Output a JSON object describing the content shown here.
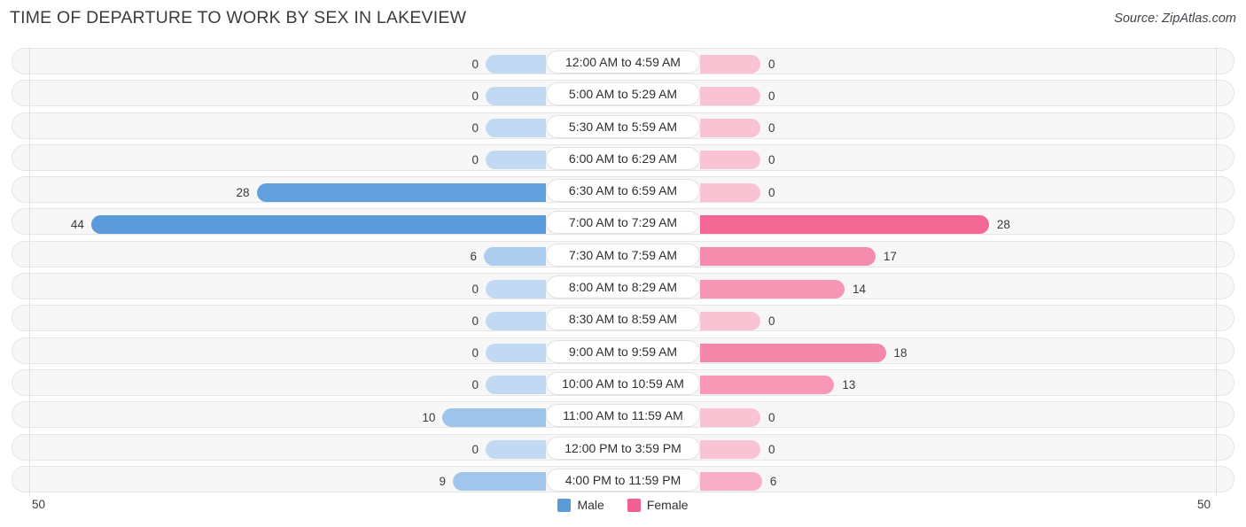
{
  "header": {
    "title": "TIME OF DEPARTURE TO WORK BY SEX IN LAKEVIEW",
    "source": "Source: ZipAtlas.com"
  },
  "footer": {
    "axis_left": "50",
    "axis_right": "50",
    "legend": [
      {
        "label": "Male",
        "color": "#5B9BDC"
      },
      {
        "label": "Female",
        "color": "#F2608F"
      }
    ]
  },
  "chart_data": {
    "type": "bar",
    "subtype": "diverging-bar",
    "title": "TIME OF DEPARTURE TO WORK BY SEX IN LAKEVIEW",
    "xlabel": "",
    "ylabel": "",
    "xlim": [
      50,
      50
    ],
    "axis_max": 50,
    "grid": false,
    "legend_position": "bottom-center",
    "categories": [
      "12:00 AM to 4:59 AM",
      "5:00 AM to 5:29 AM",
      "5:30 AM to 5:59 AM",
      "6:00 AM to 6:29 AM",
      "6:30 AM to 6:59 AM",
      "7:00 AM to 7:29 AM",
      "7:30 AM to 7:59 AM",
      "8:00 AM to 8:29 AM",
      "8:30 AM to 8:59 AM",
      "9:00 AM to 9:59 AM",
      "10:00 AM to 10:59 AM",
      "11:00 AM to 11:59 AM",
      "12:00 PM to 3:59 PM",
      "4:00 PM to 11:59 PM"
    ],
    "series": [
      {
        "name": "Male",
        "color": "#5B9BDC",
        "values": [
          0,
          0,
          0,
          0,
          28,
          44,
          6,
          0,
          0,
          0,
          0,
          10,
          0,
          9
        ]
      },
      {
        "name": "Female",
        "color": "#F2608F",
        "values": [
          0,
          0,
          0,
          0,
          0,
          28,
          17,
          14,
          0,
          18,
          13,
          0,
          0,
          6
        ]
      }
    ],
    "labels": {
      "male": [
        "0",
        "0",
        "0",
        "0",
        "28",
        "44",
        "6",
        "0",
        "0",
        "0",
        "0",
        "10",
        "0",
        "9"
      ],
      "female": [
        "0",
        "0",
        "0",
        "0",
        "0",
        "28",
        "17",
        "14",
        "0",
        "18",
        "13",
        "0",
        "0",
        "6"
      ]
    }
  }
}
